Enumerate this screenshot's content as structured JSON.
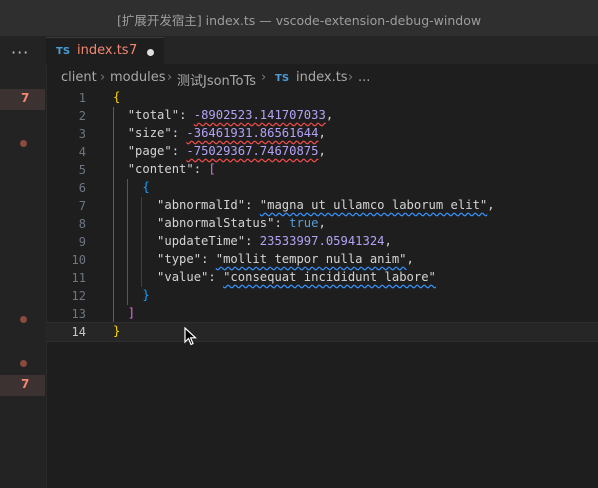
{
  "window": {
    "title": "[扩展开发宿主] index.ts — vscode-extension-debug-window"
  },
  "activity_bar": {
    "more_icon": "ellipsis-icon",
    "badges": [
      {
        "label": "7"
      },
      {
        "label": "7"
      }
    ]
  },
  "tab": {
    "icon_label": "TS",
    "label": "index.ts",
    "problems": "7",
    "dirty": true
  },
  "breadcrumb": {
    "items": [
      "client",
      "modules",
      "测试JsonToTs",
      "index.ts",
      "..."
    ],
    "file_icon": "TS"
  },
  "editor": {
    "lines": [
      {
        "n": "1",
        "text": "{"
      },
      {
        "n": "2",
        "text": "\"total\": -8902523.141707033,"
      },
      {
        "n": "3",
        "text": "\"size\": -36461931.86561644,"
      },
      {
        "n": "4",
        "text": "\"page\": -75029367.74670875,"
      },
      {
        "n": "5",
        "text": "\"content\": ["
      },
      {
        "n": "6",
        "text": "{"
      },
      {
        "n": "7",
        "text": "\"abnormalId\": \"magna ut ullamco laborum elit\","
      },
      {
        "n": "8",
        "text": "\"abnormalStatus\": true,"
      },
      {
        "n": "9",
        "text": "\"updateTime\": 23533997.05941324,"
      },
      {
        "n": "10",
        "text": "\"type\": \"mollit tempor nulla anim\","
      },
      {
        "n": "11",
        "text": "\"value\": \"consequat incididunt labore\""
      },
      {
        "n": "12",
        "text": "}"
      },
      {
        "n": "13",
        "text": "]"
      },
      {
        "n": "14",
        "text": "}"
      }
    ],
    "tokens": {
      "l2_key": "\"total\"",
      "l2_val": "-8902523.141707033",
      "l3_key": "\"size\"",
      "l3_val": "-36461931.86561644",
      "l4_key": "\"page\"",
      "l4_val": "-75029367.74670875",
      "l5_key": "\"content\"",
      "l7_key": "\"abnormalId\"",
      "l7_val": "\"magna ut ullamco laborum elit\"",
      "l8_key": "\"abnormalStatus\"",
      "l8_val": "true",
      "l9_key": "\"updateTime\"",
      "l9_val": "23533997.05941324",
      "l10_key": "\"type\"",
      "l10_val": "\"mollit tempor nulla anim\"",
      "l11_key": "\"value\"",
      "l11_val": "\"consequat incididunt labore\""
    },
    "active_line": "14"
  },
  "colors": {
    "background": "#1e1e1e",
    "error": "#f48771",
    "bracket_gold": "#ffd700",
    "bracket_purple": "#da70d6",
    "bracket_blue": "#179fff",
    "number": "#b5a2f5",
    "boolean": "#569cd6",
    "ts_icon": "#4b9bd6"
  }
}
